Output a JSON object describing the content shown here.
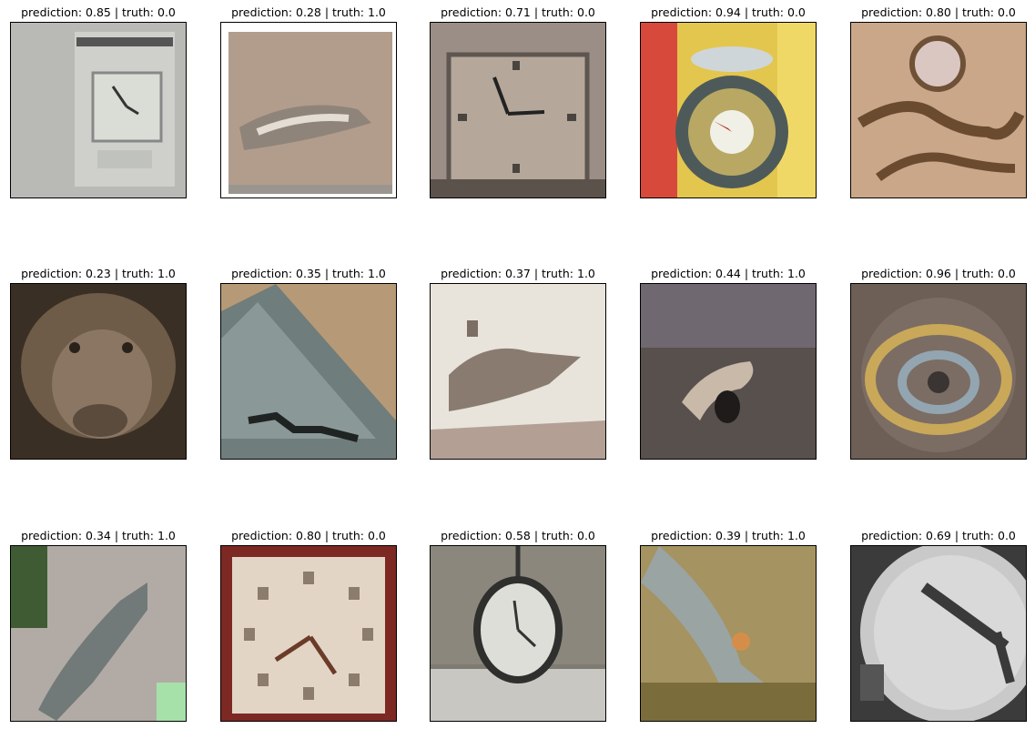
{
  "figure": {
    "panels": [
      {
        "title": "prediction: 0.85 | truth: 0.0",
        "subject": "clock"
      },
      {
        "title": "prediction: 0.28 | truth: 1.0",
        "subject": "crocodile"
      },
      {
        "title": "prediction: 0.71 | truth: 0.0",
        "subject": "clock"
      },
      {
        "title": "prediction: 0.94 | truth: 0.0",
        "subject": "clock"
      },
      {
        "title": "prediction: 0.80 | truth: 0.0",
        "subject": "clock"
      },
      {
        "title": "prediction: 0.23 | truth: 1.0",
        "subject": "animal"
      },
      {
        "title": "prediction: 0.35 | truth: 1.0",
        "subject": "crocodile"
      },
      {
        "title": "prediction: 0.37 | truth: 1.0",
        "subject": "crocodile"
      },
      {
        "title": "prediction: 0.44 | truth: 1.0",
        "subject": "crocodile"
      },
      {
        "title": "prediction: 0.96 | truth: 0.0",
        "subject": "clock"
      },
      {
        "title": "prediction: 0.34 | truth: 1.0",
        "subject": "crocodile"
      },
      {
        "title": "prediction: 0.80 | truth: 0.0",
        "subject": "clock"
      },
      {
        "title": "prediction: 0.58 | truth: 0.0",
        "subject": "clock"
      },
      {
        "title": "prediction: 0.39 | truth: 1.0",
        "subject": "crocodile"
      },
      {
        "title": "prediction: 0.69 | truth: 0.0",
        "subject": "clock"
      }
    ]
  }
}
